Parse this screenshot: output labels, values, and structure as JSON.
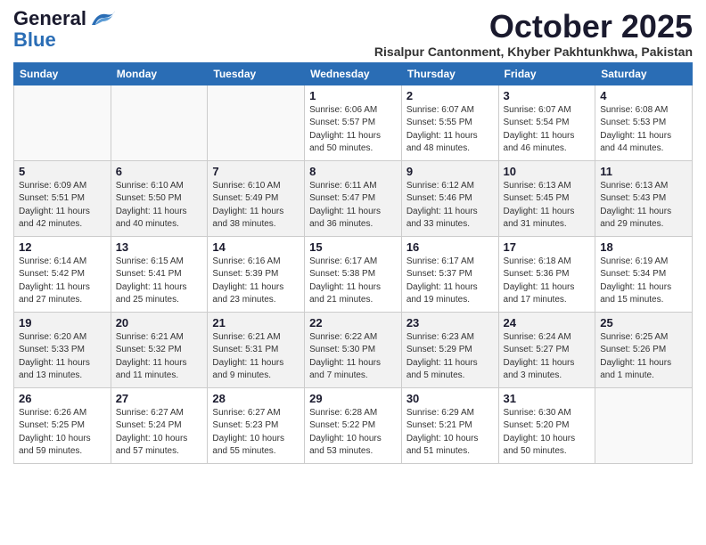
{
  "header": {
    "logo_general": "General",
    "logo_blue": "Blue",
    "month": "October 2025",
    "location": "Risalpur Cantonment, Khyber Pakhtunkhwa, Pakistan"
  },
  "days_of_week": [
    "Sunday",
    "Monday",
    "Tuesday",
    "Wednesday",
    "Thursday",
    "Friday",
    "Saturday"
  ],
  "weeks": [
    [
      {
        "day": "",
        "info": ""
      },
      {
        "day": "",
        "info": ""
      },
      {
        "day": "",
        "info": ""
      },
      {
        "day": "1",
        "info": "Sunrise: 6:06 AM\nSunset: 5:57 PM\nDaylight: 11 hours\nand 50 minutes."
      },
      {
        "day": "2",
        "info": "Sunrise: 6:07 AM\nSunset: 5:55 PM\nDaylight: 11 hours\nand 48 minutes."
      },
      {
        "day": "3",
        "info": "Sunrise: 6:07 AM\nSunset: 5:54 PM\nDaylight: 11 hours\nand 46 minutes."
      },
      {
        "day": "4",
        "info": "Sunrise: 6:08 AM\nSunset: 5:53 PM\nDaylight: 11 hours\nand 44 minutes."
      }
    ],
    [
      {
        "day": "5",
        "info": "Sunrise: 6:09 AM\nSunset: 5:51 PM\nDaylight: 11 hours\nand 42 minutes."
      },
      {
        "day": "6",
        "info": "Sunrise: 6:10 AM\nSunset: 5:50 PM\nDaylight: 11 hours\nand 40 minutes."
      },
      {
        "day": "7",
        "info": "Sunrise: 6:10 AM\nSunset: 5:49 PM\nDaylight: 11 hours\nand 38 minutes."
      },
      {
        "day": "8",
        "info": "Sunrise: 6:11 AM\nSunset: 5:47 PM\nDaylight: 11 hours\nand 36 minutes."
      },
      {
        "day": "9",
        "info": "Sunrise: 6:12 AM\nSunset: 5:46 PM\nDaylight: 11 hours\nand 33 minutes."
      },
      {
        "day": "10",
        "info": "Sunrise: 6:13 AM\nSunset: 5:45 PM\nDaylight: 11 hours\nand 31 minutes."
      },
      {
        "day": "11",
        "info": "Sunrise: 6:13 AM\nSunset: 5:43 PM\nDaylight: 11 hours\nand 29 minutes."
      }
    ],
    [
      {
        "day": "12",
        "info": "Sunrise: 6:14 AM\nSunset: 5:42 PM\nDaylight: 11 hours\nand 27 minutes."
      },
      {
        "day": "13",
        "info": "Sunrise: 6:15 AM\nSunset: 5:41 PM\nDaylight: 11 hours\nand 25 minutes."
      },
      {
        "day": "14",
        "info": "Sunrise: 6:16 AM\nSunset: 5:39 PM\nDaylight: 11 hours\nand 23 minutes."
      },
      {
        "day": "15",
        "info": "Sunrise: 6:17 AM\nSunset: 5:38 PM\nDaylight: 11 hours\nand 21 minutes."
      },
      {
        "day": "16",
        "info": "Sunrise: 6:17 AM\nSunset: 5:37 PM\nDaylight: 11 hours\nand 19 minutes."
      },
      {
        "day": "17",
        "info": "Sunrise: 6:18 AM\nSunset: 5:36 PM\nDaylight: 11 hours\nand 17 minutes."
      },
      {
        "day": "18",
        "info": "Sunrise: 6:19 AM\nSunset: 5:34 PM\nDaylight: 11 hours\nand 15 minutes."
      }
    ],
    [
      {
        "day": "19",
        "info": "Sunrise: 6:20 AM\nSunset: 5:33 PM\nDaylight: 11 hours\nand 13 minutes."
      },
      {
        "day": "20",
        "info": "Sunrise: 6:21 AM\nSunset: 5:32 PM\nDaylight: 11 hours\nand 11 minutes."
      },
      {
        "day": "21",
        "info": "Sunrise: 6:21 AM\nSunset: 5:31 PM\nDaylight: 11 hours\nand 9 minutes."
      },
      {
        "day": "22",
        "info": "Sunrise: 6:22 AM\nSunset: 5:30 PM\nDaylight: 11 hours\nand 7 minutes."
      },
      {
        "day": "23",
        "info": "Sunrise: 6:23 AM\nSunset: 5:29 PM\nDaylight: 11 hours\nand 5 minutes."
      },
      {
        "day": "24",
        "info": "Sunrise: 6:24 AM\nSunset: 5:27 PM\nDaylight: 11 hours\nand 3 minutes."
      },
      {
        "day": "25",
        "info": "Sunrise: 6:25 AM\nSunset: 5:26 PM\nDaylight: 11 hours\nand 1 minute."
      }
    ],
    [
      {
        "day": "26",
        "info": "Sunrise: 6:26 AM\nSunset: 5:25 PM\nDaylight: 10 hours\nand 59 minutes."
      },
      {
        "day": "27",
        "info": "Sunrise: 6:27 AM\nSunset: 5:24 PM\nDaylight: 10 hours\nand 57 minutes."
      },
      {
        "day": "28",
        "info": "Sunrise: 6:27 AM\nSunset: 5:23 PM\nDaylight: 10 hours\nand 55 minutes."
      },
      {
        "day": "29",
        "info": "Sunrise: 6:28 AM\nSunset: 5:22 PM\nDaylight: 10 hours\nand 53 minutes."
      },
      {
        "day": "30",
        "info": "Sunrise: 6:29 AM\nSunset: 5:21 PM\nDaylight: 10 hours\nand 51 minutes."
      },
      {
        "day": "31",
        "info": "Sunrise: 6:30 AM\nSunset: 5:20 PM\nDaylight: 10 hours\nand 50 minutes."
      },
      {
        "day": "",
        "info": ""
      }
    ]
  ]
}
